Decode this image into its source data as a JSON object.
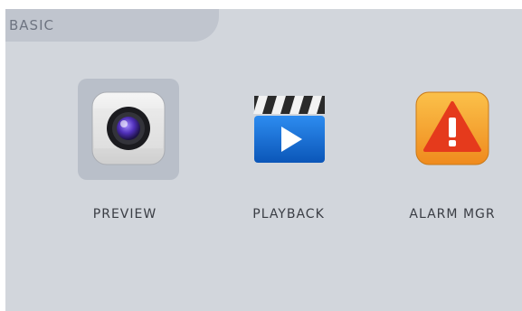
{
  "tab": {
    "label": "BASIC"
  },
  "apps": [
    {
      "label": "PREVIEW",
      "icon": "camera-lens-icon",
      "selected": true
    },
    {
      "label": "PLAYBACK",
      "icon": "clapperboard-play-icon",
      "selected": false
    },
    {
      "label": "ALARM MGR",
      "icon": "alarm-warning-icon",
      "selected": false
    }
  ],
  "colors": {
    "panel": "#d2d6dc",
    "tab": "#c0c5ce",
    "selected_tile": "#b9bfc9",
    "playback_blue": "#1a73d8",
    "alarm_orange": "#f7a02a",
    "alarm_red": "#e53a1c"
  }
}
